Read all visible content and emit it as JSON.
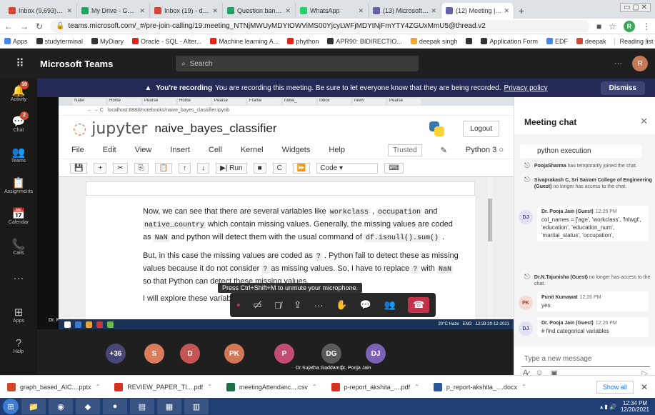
{
  "browser": {
    "tabs": [
      {
        "label": "Inbox (9,693) - rekha",
        "color": "#d44638",
        "active": false
      },
      {
        "label": "My Drive - Google D",
        "color": "#1fa463",
        "active": false
      },
      {
        "label": "Inbox (19) - dinesh.g",
        "color": "#d44638",
        "active": false
      },
      {
        "label": "Question bank - Goo",
        "color": "#1fa463",
        "active": false
      },
      {
        "label": "WhatsApp",
        "color": "#25d366",
        "active": false
      },
      {
        "label": "(13) Microsoft Teams",
        "color": "#6264a7",
        "active": false
      },
      {
        "label": "(12) Meeting | M",
        "color": "#6264a7",
        "active": true
      }
    ],
    "url": "teams.microsoft.com/_#/pre-join-calling/19:meeting_NTNjMWUyMDYtOWViMS00YjcyLWFjMDYtNjFmYTY4ZGUxMmU5@thread.v2",
    "profile_initial": "R",
    "bookmarks": [
      {
        "label": "Apps",
        "color": "#4285f4"
      },
      {
        "label": "studyterminal",
        "color": "#333333"
      },
      {
        "label": "MyDiary",
        "color": "#333333"
      },
      {
        "label": "Oracle - SQL - Alter...",
        "color": "#e62117"
      },
      {
        "label": "Machine learning A...",
        "color": "#e62117"
      },
      {
        "label": "phython",
        "color": "#e62117"
      },
      {
        "label": "APR90: BIDIRECTIO...",
        "color": "#333333"
      },
      {
        "label": "deepak singh",
        "color": "#f5a623"
      },
      {
        "label": "",
        "color": "#333333"
      },
      {
        "label": "Application Form",
        "color": "#333333"
      },
      {
        "label": "EDF",
        "color": "#4285f4"
      },
      {
        "label": "deepak",
        "color": "#d44638"
      }
    ],
    "reading_list": "Reading list"
  },
  "teams": {
    "brand": "Microsoft Teams",
    "search_placeholder": "Search",
    "user_initial": "R",
    "rail": [
      {
        "label": "Activity",
        "icon": "bell-icon",
        "badge": "10"
      },
      {
        "label": "Chat",
        "icon": "chat-icon",
        "badge": "2"
      },
      {
        "label": "Teams",
        "icon": "teams-icon",
        "badge": ""
      },
      {
        "label": "Assignments",
        "icon": "assignments-icon",
        "badge": ""
      },
      {
        "label": "Calendar",
        "icon": "calendar-icon",
        "badge": ""
      },
      {
        "label": "Calls",
        "icon": "phone-icon",
        "badge": ""
      },
      {
        "label": "...",
        "icon": "more-icon",
        "badge": ""
      }
    ],
    "rail_bottom": [
      {
        "label": "Apps",
        "icon": "apps-icon"
      },
      {
        "label": "Help",
        "icon": "help-icon"
      }
    ],
    "recording": {
      "bold": "You're recording",
      "text": "You are recording this meeting. Be sure to let everyone know that they are being recorded.",
      "link": "Privacy policy",
      "dismiss": "Dismiss"
    }
  },
  "shared_screen": {
    "inner_tabs": [
      "Nater",
      "Home",
      "Pearse",
      "Home",
      "Pearse",
      "Frame",
      "naive_",
      "Inbox",
      "news",
      "Pearse"
    ],
    "inner_url": "localhost:8888/notebooks/naive_bayes_classifier.ipynb",
    "jupyter": {
      "logo": "jupyter",
      "notebook": "naive_bayes_classifier",
      "logout": "Logout",
      "menu": [
        "File",
        "Edit",
        "View",
        "Insert",
        "Cell",
        "Kernel",
        "Widgets",
        "Help"
      ],
      "trusted": "Trusted",
      "kernel": "Python 3",
      "run_label": "Run",
      "cell_type": "Code"
    },
    "paragraphs": [
      [
        {
          "t": "Now, we can see that there are several variables like "
        },
        {
          "c": "workclass"
        },
        {
          "t": " , "
        },
        {
          "c": "occupation"
        },
        {
          "t": " and "
        },
        {
          "c": "native_country"
        },
        {
          "t": " which contain missing values. Generally, the missing values are coded as "
        },
        {
          "c": "NaN"
        },
        {
          "t": " and python will detect them with the usual command of "
        },
        {
          "c": "df.isnull().sum()"
        },
        {
          "t": " ."
        }
      ],
      [
        {
          "t": "But, in this case the missing values are coded as "
        },
        {
          "c": "?"
        },
        {
          "t": " . Python fail to detect these as missing values because it do not consider "
        },
        {
          "c": "?"
        },
        {
          "t": " as missing values. So, I have to replace "
        },
        {
          "c": "?"
        },
        {
          "t": " with "
        },
        {
          "c": "NaN"
        },
        {
          "t": " so that Python can detect these missing values."
        }
      ],
      [
        {
          "t": "I will explore these variab"
        }
      ]
    ],
    "presenter_name": "Dr. Pooja Jain",
    "taskbar_weather": "20°C Haze",
    "taskbar_lang": "ENG",
    "taskbar_time": "12:33",
    "taskbar_date": "20-12-2021"
  },
  "meeting_controls": {
    "unmute_tip": "Press Ctrl+Shift+M to unmute your microphone.",
    "timer": "●"
  },
  "participants": [
    {
      "initials": "+36",
      "color": "#464775",
      "name": ""
    },
    {
      "initials": "S",
      "color": "#d87c5c",
      "name": ""
    },
    {
      "initials": "D",
      "color": "#c65555",
      "name": ""
    },
    {
      "initials": "PK",
      "color": "#d27658",
      "name": ""
    },
    {
      "initials": "P",
      "color": "#c24d73",
      "name": ""
    },
    {
      "initials": "DG",
      "color": "#5a5a5a",
      "name": "Dr.Sujatha Gaddam (..."
    },
    {
      "initials": "DJ",
      "color": "#7b61b3",
      "name": "Dr. Pooja Jain"
    }
  ],
  "chat": {
    "title": "Meeting chat",
    "messages": [
      {
        "kind": "card",
        "text": "python execution"
      },
      {
        "kind": "system",
        "name": "PoojaSharma",
        "text": "has temporarily joined the chat."
      },
      {
        "kind": "system",
        "name": "Sivaprakash C, Sri Sairam College of Engineering (Guest)",
        "text": "no longer has access to the chat."
      },
      {
        "kind": "msg",
        "initials": "DJ",
        "author": "Dr. Pooja Jain (Guest)",
        "time": "12:25 PM",
        "body": "col_names = ['age', 'workclass', 'fnlwgt', 'education', 'education_num', 'marital_status', 'occupation',"
      },
      {
        "kind": "system",
        "name": "Dr.N.Tajunisha (Guest)",
        "text": "no longer has access to the chat."
      },
      {
        "kind": "msg",
        "initials": "PK",
        "author": "Punit Kumawat",
        "time": "12:26 PM",
        "body": "yes"
      },
      {
        "kind": "msg",
        "initials": "DJ",
        "author": "Dr. Pooja Jain (Guest)",
        "time": "12:26 PM",
        "body": "# find categorical variables"
      }
    ],
    "input_placeholder": "Type a new message"
  },
  "downloads": [
    {
      "name": "graph_based_AIC....pptx",
      "color": "#d24726"
    },
    {
      "name": "REVIEW_PAPER_TI....pdf",
      "color": "#d93025"
    },
    {
      "name": "meetingAttendanc....csv",
      "color": "#1e7145"
    },
    {
      "name": "p-report_akshita_....pdf",
      "color": "#d93025"
    },
    {
      "name": "p_report-akshita_....docx",
      "color": "#2b579a"
    }
  ],
  "downloads_show_all": "Show all",
  "taskbar": {
    "time": "12:34 PM",
    "date": "12/20/2021"
  }
}
